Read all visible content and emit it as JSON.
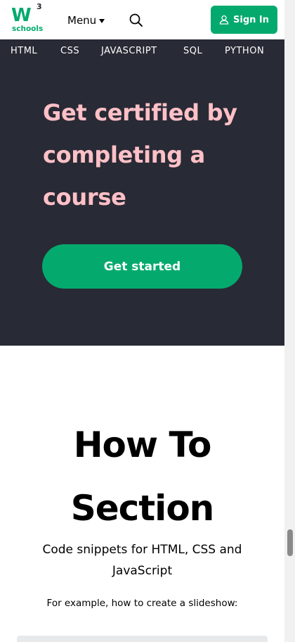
{
  "header": {
    "logo": {
      "mark": "W",
      "superscript": "3",
      "text": "schools"
    },
    "menu_label": "Menu",
    "signin_label": "Sign In",
    "icons": {
      "search": "search-icon",
      "user": "user-icon",
      "menu_caret": "caret-down-icon"
    }
  },
  "nav": {
    "items": [
      {
        "label": "HTML"
      },
      {
        "label": "CSS"
      },
      {
        "label": "JAVASCRIPT"
      },
      {
        "label": "SQL"
      },
      {
        "label": "PYTHON"
      }
    ]
  },
  "hero": {
    "title": "Get certified by completing a course",
    "cta_label": "Get started"
  },
  "howto": {
    "title_line1": "How To",
    "title_line2": "Section",
    "subtitle": "Code snippets for HTML, CSS and JavaScript",
    "example_text": "For example, how to create a slideshow:"
  },
  "colors": {
    "brand_green": "#04AA6D",
    "dark_bg": "#282A35",
    "hero_text": "#FFC0C7"
  }
}
